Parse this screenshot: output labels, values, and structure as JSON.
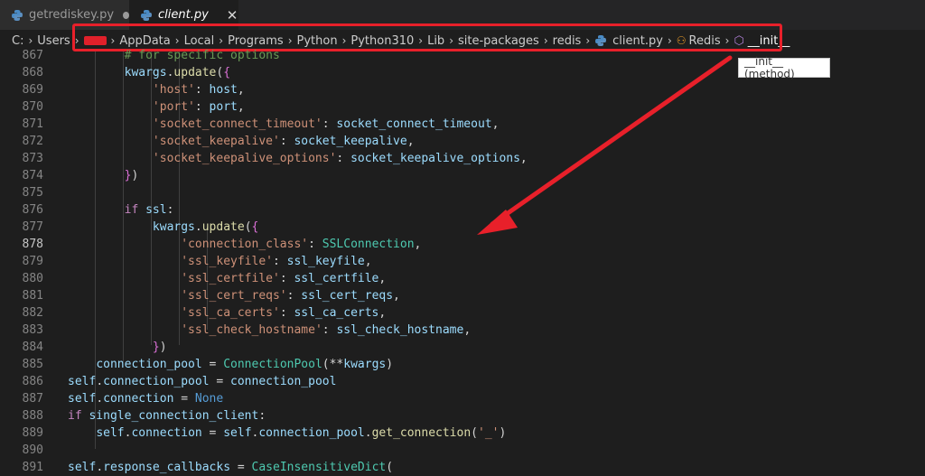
{
  "tabs": [
    {
      "label": "getrediskey.py",
      "modified": true
    },
    {
      "label": "client.py",
      "close": "✕"
    }
  ],
  "breadcrumb": {
    "items": [
      "C:",
      "Users",
      "AppData",
      "Local",
      "Programs",
      "Python",
      "Python310",
      "Lib",
      "site-packages",
      "redis",
      "client.py",
      "Redis",
      "__init__"
    ]
  },
  "tooltip": "__init__ (method)",
  "editor": {
    "active_line": 878,
    "lines": [
      {
        "n": "867",
        "code": "        # for specific options"
      },
      {
        "n": "868",
        "code": "        kwargs.update({"
      },
      {
        "n": "869",
        "code": "            'host': host,"
      },
      {
        "n": "870",
        "code": "            'port': port,"
      },
      {
        "n": "871",
        "code": "            'socket_connect_timeout': socket_connect_timeout,"
      },
      {
        "n": "872",
        "code": "            'socket_keepalive': socket_keepalive,"
      },
      {
        "n": "873",
        "code": "            'socket_keepalive_options': socket_keepalive_options,"
      },
      {
        "n": "874",
        "code": "        })"
      },
      {
        "n": "875",
        "code": ""
      },
      {
        "n": "876",
        "code": "        if ssl:"
      },
      {
        "n": "877",
        "code": "            kwargs.update({"
      },
      {
        "n": "878",
        "code": "                'connection_class': SSLConnection,"
      },
      {
        "n": "879",
        "code": "                'ssl_keyfile': ssl_keyfile,"
      },
      {
        "n": "880",
        "code": "                'ssl_certfile': ssl_certfile,"
      },
      {
        "n": "881",
        "code": "                'ssl_cert_reqs': ssl_cert_reqs,"
      },
      {
        "n": "882",
        "code": "                'ssl_ca_certs': ssl_ca_certs,"
      },
      {
        "n": "883",
        "code": "                'ssl_check_hostname': ssl_check_hostname,"
      },
      {
        "n": "884",
        "code": "            })"
      },
      {
        "n": "885",
        "code": "    connection_pool = ConnectionPool(**kwargs)"
      },
      {
        "n": "886",
        "code": "self.connection_pool = connection_pool"
      },
      {
        "n": "887",
        "code": "self.connection = None"
      },
      {
        "n": "888",
        "code": "if single_connection_client:"
      },
      {
        "n": "889",
        "code": "    self.connection = self.connection_pool.get_connection('_')"
      },
      {
        "n": "890",
        "code": ""
      },
      {
        "n": "891",
        "code": "self.response_callbacks = CaseInsensitiveDict("
      }
    ]
  },
  "colors": {
    "annotation": "#e8202a",
    "editor_bg": "#1e1e1e",
    "string": "#ce9178",
    "variable": "#9cdcfe",
    "class": "#4ec9b0"
  }
}
